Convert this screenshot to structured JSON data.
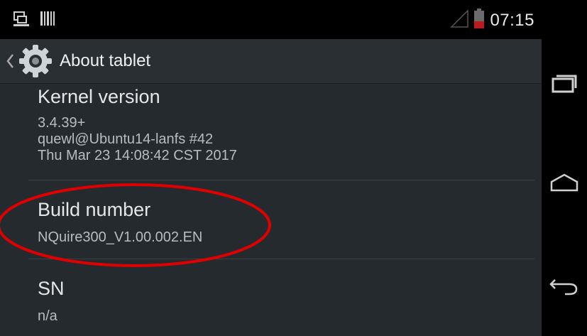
{
  "status_bar": {
    "time": "07:15",
    "icons": [
      "screenshot-icon",
      "barcode-icon",
      "signal-icon",
      "battery-icon"
    ],
    "battery_color": "#b71c1c"
  },
  "action_bar": {
    "title": "About tablet",
    "icons": [
      "back-caret-icon",
      "settings-gear-icon"
    ]
  },
  "settings_items": [
    {
      "title": "Kernel version",
      "summary": "3.4.39+\nquewl@Ubuntu14-lanfs #42\nThu Mar 23 14:08:42 CST 2017"
    },
    {
      "title": "Build number",
      "summary": "NQuire300_V1.00.002.EN"
    },
    {
      "title": "SN",
      "summary": "n/a"
    }
  ],
  "annotation": {
    "type": "ellipse",
    "color": "#e00000",
    "highlights": "Build number"
  },
  "navigation_bar": {
    "buttons": [
      "recent-apps-icon",
      "home-icon",
      "back-icon"
    ]
  },
  "colors": {
    "background": "#252a2f",
    "action_bar": "#2a2f33",
    "text_primary": "#e6e6e6",
    "text_secondary": "#b9bcbf"
  }
}
